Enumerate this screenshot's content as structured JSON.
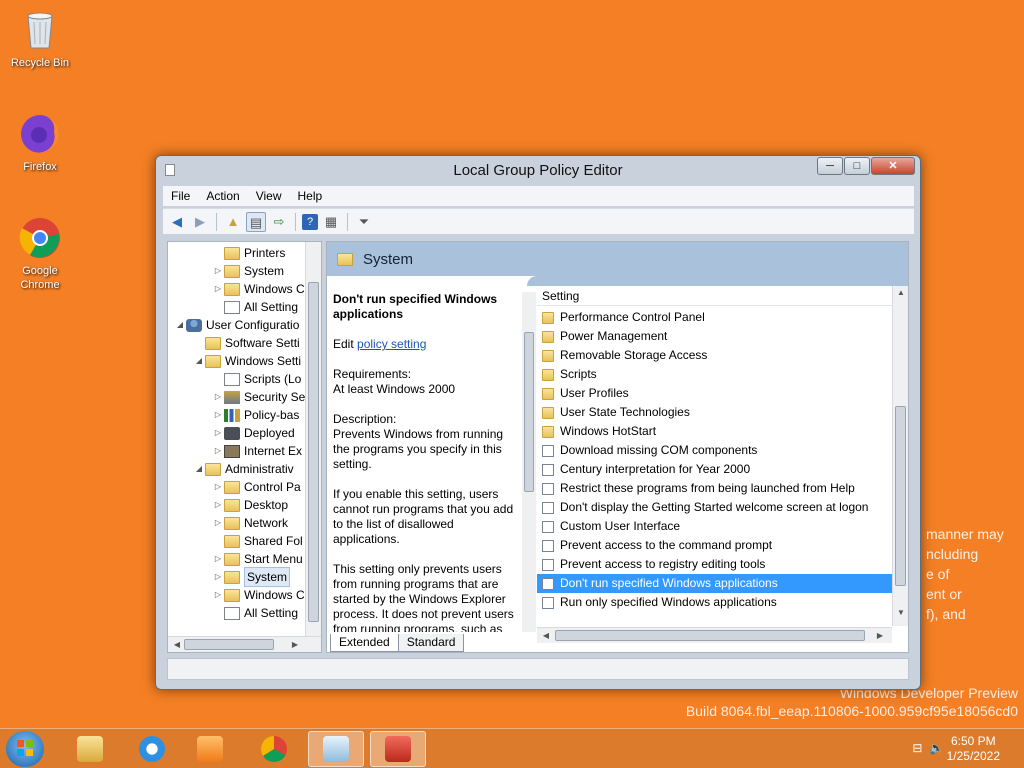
{
  "desktop": {
    "icons": [
      {
        "label": "Recycle Bin"
      },
      {
        "label": "Firefox"
      },
      {
        "label": "Google Chrome"
      }
    ],
    "background_text_lines": [
      "manner may",
      "ncluding",
      "e of",
      "ent or",
      "f), and"
    ],
    "watermark": {
      "line1": "Windows Developer Preview",
      "line2": "Build 8064.fbl_eeap.110806-1000.959cf95e18056cd0"
    }
  },
  "window": {
    "title": "Local Group Policy Editor",
    "controls": {
      "minimize": "─",
      "maximize": "□",
      "close": "✕"
    },
    "menu": [
      "File",
      "Action",
      "View",
      "Help"
    ],
    "tree": [
      {
        "label": "Printers",
        "arrow": ""
      },
      {
        "label": "System",
        "arrow": "▷"
      },
      {
        "label": "Windows C",
        "arrow": "▷"
      },
      {
        "label": "All Setting",
        "arrow": ""
      },
      {
        "label": "User Configuratio",
        "arrow": "◢"
      },
      {
        "label": "Software Setti",
        "arrow": ""
      },
      {
        "label": "Windows Setti",
        "arrow": "◢"
      },
      {
        "label": "Scripts (Lo",
        "arrow": ""
      },
      {
        "label": "Security Se",
        "arrow": "▷"
      },
      {
        "label": "Policy-bas",
        "arrow": "▷"
      },
      {
        "label": "Deployed",
        "arrow": "▷"
      },
      {
        "label": "Internet Ex",
        "arrow": "▷"
      },
      {
        "label": "Administrativ",
        "arrow": "◢"
      },
      {
        "label": "Control Pa",
        "arrow": "▷"
      },
      {
        "label": "Desktop",
        "arrow": "▷"
      },
      {
        "label": "Network",
        "arrow": "▷"
      },
      {
        "label": "Shared Fol",
        "arrow": ""
      },
      {
        "label": "Start Menu",
        "arrow": "▷"
      },
      {
        "label": "System",
        "arrow": "▷"
      },
      {
        "label": "Windows C",
        "arrow": "▷"
      },
      {
        "label": "All Setting",
        "arrow": ""
      }
    ],
    "right": {
      "header": "System",
      "desc_title": "Don't run specified Windows applications",
      "edit_prefix": "Edit",
      "edit_link": "policy setting",
      "req_label": "Requirements:",
      "req_value": "At least Windows 2000",
      "desc_label": "Description:",
      "desc_p1": "Prevents Windows from running the programs you specify in this setting.",
      "desc_p2": "If you enable this setting, users cannot run programs that you add to the list of disallowed applications.",
      "desc_p3": "This setting only prevents users from running programs that are started by the Windows Explorer process. It does not prevent users from running programs, such as",
      "column_header": "Setting",
      "settings": [
        {
          "label": "Performance Control Panel",
          "type": "folder"
        },
        {
          "label": "Power Management",
          "type": "folder"
        },
        {
          "label": "Removable Storage Access",
          "type": "folder"
        },
        {
          "label": "Scripts",
          "type": "folder"
        },
        {
          "label": "User Profiles",
          "type": "folder"
        },
        {
          "label": "User State Technologies",
          "type": "folder"
        },
        {
          "label": "Windows HotStart",
          "type": "folder"
        },
        {
          "label": "Download missing COM components",
          "type": "setting"
        },
        {
          "label": "Century interpretation for Year 2000",
          "type": "setting"
        },
        {
          "label": "Restrict these programs from being launched from Help",
          "type": "setting"
        },
        {
          "label": "Don't display the Getting Started welcome screen at logon",
          "type": "setting"
        },
        {
          "label": "Custom User Interface",
          "type": "setting"
        },
        {
          "label": "Prevent access to the command prompt",
          "type": "setting"
        },
        {
          "label": "Prevent access to registry editing tools",
          "type": "setting"
        },
        {
          "label": "Don't run specified Windows applications",
          "type": "setting"
        },
        {
          "label": "Run only specified Windows applications",
          "type": "setting"
        }
      ],
      "selected_setting": "Don't run specified Windows applications",
      "tabs": [
        "Extended",
        "Standard"
      ]
    }
  },
  "taskbar": {
    "clock_time": "6:50 PM",
    "clock_date": "1/25/2022"
  },
  "colors": {
    "desktop": "#f47f24",
    "selection": "#3399ff",
    "header": "#a9c1da"
  }
}
